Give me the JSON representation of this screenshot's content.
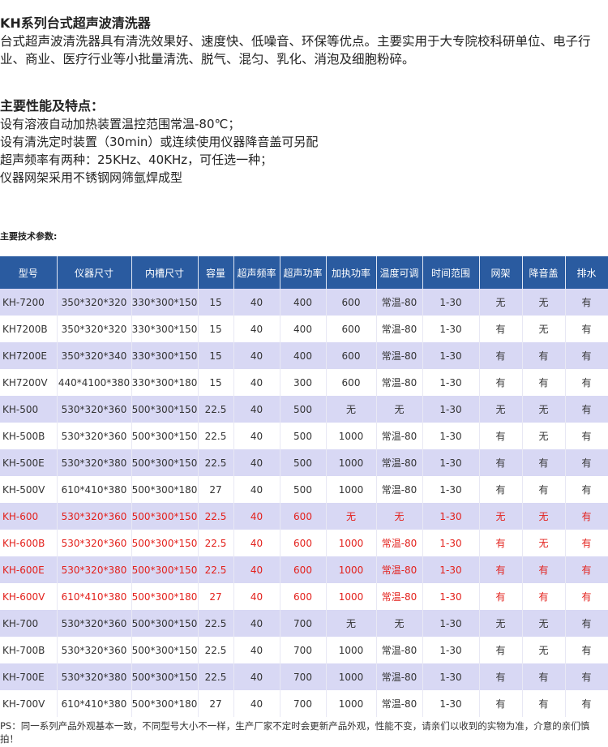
{
  "intro": {
    "title": "KH系列台式超声波清洗器",
    "text": "台式超声波清洗器具有清洗效果好、速度快、低噪音、环保等优点。主要实用于大专院校科研单位、电子行业、商业、医疗行业等小批量清洗、脱气、混匀、乳化、消泡及细胞粉碎。"
  },
  "features": {
    "title": "主要性能及特点：",
    "lines": [
      "设有溶液自动加热装置温控范围常温-80℃；",
      "设有清洗定时装置（30min）或连续使用仪器降音盖可另配",
      "超声频率有两种：25KHz、40KHz，可任选一种；",
      "仪器网架采用不锈钢网筛氩焊成型"
    ]
  },
  "params_title": "主要技术参数:",
  "table": {
    "headers": [
      "型号",
      "仪器尺寸",
      "内槽尺寸",
      "容量",
      "超声频率",
      "超声功率",
      "加执功率",
      "温度可调",
      "时间范围",
      "网架",
      "降音盖",
      "排水"
    ],
    "rows": [
      {
        "cells": [
          "KH-7200",
          "350*320*320",
          "330*300*150",
          "15",
          "40",
          "400",
          "600",
          "常温-80",
          "1-30",
          "无",
          "无",
          "有"
        ],
        "red": false
      },
      {
        "cells": [
          "KH7200B",
          "350*320*320",
          "330*300*150",
          "15",
          "40",
          "400",
          "600",
          "常温-80",
          "1-30",
          "有",
          "无",
          "有"
        ],
        "red": false
      },
      {
        "cells": [
          "KH7200E",
          "350*320*340",
          "330*300*150",
          "15",
          "40",
          "400",
          "600",
          "常温-80",
          "1-30",
          "有",
          "有",
          "有"
        ],
        "red": false
      },
      {
        "cells": [
          "KH7200V",
          "440*4100*380",
          "330*300*180",
          "15",
          "40",
          "300",
          "600",
          "常温-80",
          "1-30",
          "有",
          "有",
          "有"
        ],
        "red": false
      },
      {
        "cells": [
          "KH-500",
          "530*320*360",
          "500*300*150",
          "22.5",
          "40",
          "500",
          "无",
          "无",
          "1-30",
          "无",
          "无",
          "有"
        ],
        "red": false
      },
      {
        "cells": [
          "KH-500B",
          "530*320*360",
          "500*300*150",
          "22.5",
          "40",
          "500",
          "1000",
          "常温-80",
          "1-30",
          "有",
          "无",
          "有"
        ],
        "red": false
      },
      {
        "cells": [
          "KH-500E",
          "530*320*380",
          "500*300*150",
          "22.5",
          "40",
          "500",
          "1000",
          "常温-80",
          "1-30",
          "有",
          "有",
          "有"
        ],
        "red": false
      },
      {
        "cells": [
          "KH-500V",
          "610*410*380",
          "500*300*180",
          "27",
          "40",
          "500",
          "1000",
          "常温-80",
          "1-30",
          "有",
          "有",
          "有"
        ],
        "red": false
      },
      {
        "cells": [
          "KH-600",
          "530*320*360",
          "500*300*150",
          "22.5",
          "40",
          "600",
          "无",
          "无",
          "1-30",
          "无",
          "无",
          "有"
        ],
        "red": true
      },
      {
        "cells": [
          "KH-600B",
          "530*320*360",
          "500*300*150",
          "22.5",
          "40",
          "600",
          "1000",
          "常温-80",
          "1-30",
          "有",
          "无",
          "有"
        ],
        "red": true
      },
      {
        "cells": [
          "KH-600E",
          "530*320*380",
          "500*300*150",
          "22.5",
          "40",
          "600",
          "1000",
          "常温-80",
          "1-30",
          "有",
          "有",
          "有"
        ],
        "red": true
      },
      {
        "cells": [
          "KH-600V",
          "610*410*380",
          "500*300*180",
          "27",
          "40",
          "600",
          "1000",
          "常温-80",
          "1-30",
          "有",
          "有",
          "有"
        ],
        "red": true
      },
      {
        "cells": [
          "KH-700",
          "530*320*360",
          "500*300*150",
          "22.5",
          "40",
          "700",
          "无",
          "无",
          "1-30",
          "无",
          "无",
          "有"
        ],
        "red": false
      },
      {
        "cells": [
          "KH-700B",
          "530*320*360",
          "500*300*150",
          "22.5",
          "40",
          "700",
          "1000",
          "常温-80",
          "1-30",
          "有",
          "无",
          "有"
        ],
        "red": false
      },
      {
        "cells": [
          "KH-700E",
          "530*320*380",
          "500*300*150",
          "22.5",
          "40",
          "700",
          "1000",
          "常温-80",
          "1-30",
          "有",
          "有",
          "有"
        ],
        "red": false
      },
      {
        "cells": [
          "KH-700V",
          "610*410*380",
          "500*300*180",
          "27",
          "40",
          "700",
          "1000",
          "常温-80",
          "1-30",
          "有",
          "有",
          "有"
        ],
        "red": false
      }
    ]
  },
  "ps": "PS：同一系列产品外观基本一致，不同型号大小不一样，生产厂家不定时会更新产品外观，性能不变，请亲们以收到的实物为准，介意的亲们慎拍！"
}
